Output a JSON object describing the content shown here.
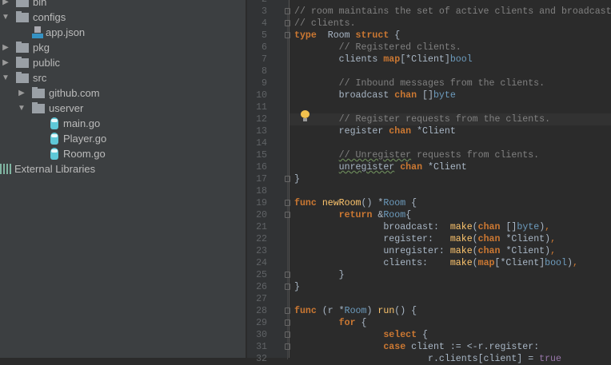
{
  "project_tree": [
    {
      "label": "bin",
      "kind": "folder",
      "depth": 0,
      "expanded": false
    },
    {
      "label": "configs",
      "kind": "folder",
      "depth": 0,
      "expanded": true
    },
    {
      "label": "app.json",
      "kind": "json-file",
      "depth": 1
    },
    {
      "label": "pkg",
      "kind": "folder",
      "depth": 0,
      "expanded": false
    },
    {
      "label": "public",
      "kind": "folder",
      "depth": 0,
      "expanded": false
    },
    {
      "label": "src",
      "kind": "folder",
      "depth": 0,
      "expanded": true
    },
    {
      "label": "github.com",
      "kind": "folder",
      "depth": 1,
      "expanded": false
    },
    {
      "label": "userver",
      "kind": "folder",
      "depth": 1,
      "expanded": true
    },
    {
      "label": "main.go",
      "kind": "go-file",
      "depth": 2
    },
    {
      "label": "Player.go",
      "kind": "go-file",
      "depth": 2
    },
    {
      "label": "Room.go",
      "kind": "go-file",
      "depth": 2
    },
    {
      "label": "External Libraries",
      "kind": "libraries",
      "depth": -1
    }
  ],
  "editor": {
    "current_line": 12,
    "intention_icon": "lightbulb-icon",
    "lines": [
      {
        "n": "2",
        "t": []
      },
      {
        "n": "3",
        "t": [
          [
            "cm",
            "// room maintains the set of active clients and broadcast"
          ]
        ]
      },
      {
        "n": "4",
        "t": [
          [
            "cm",
            "// clients."
          ]
        ]
      },
      {
        "n": "5",
        "t": [
          [
            "kw",
            "type"
          ],
          [
            "",
            "  Room "
          ],
          [
            "kw",
            "struct"
          ],
          [
            "",
            " {"
          ]
        ]
      },
      {
        "n": "6",
        "t": [
          [
            "",
            "\t"
          ],
          [
            "cm",
            "// Registered clients."
          ]
        ]
      },
      {
        "n": "7",
        "t": [
          [
            "",
            "\tclients "
          ],
          [
            "kw",
            "map"
          ],
          [
            "",
            "[*Client]"
          ],
          [
            "ty",
            "bool"
          ]
        ]
      },
      {
        "n": "8",
        "t": []
      },
      {
        "n": "9",
        "t": [
          [
            "",
            "\t"
          ],
          [
            "cm",
            "// Inbound messages from the clients."
          ]
        ]
      },
      {
        "n": "10",
        "t": [
          [
            "",
            "\tbroadcast "
          ],
          [
            "kw",
            "chan"
          ],
          [
            "",
            " []"
          ],
          [
            "ty",
            "byte"
          ]
        ]
      },
      {
        "n": "11",
        "t": []
      },
      {
        "n": "12",
        "t": [
          [
            "",
            "\t"
          ],
          [
            "cm",
            "// Register requests from the clients."
          ]
        ]
      },
      {
        "n": "13",
        "t": [
          [
            "",
            "\tregister "
          ],
          [
            "kw",
            "chan"
          ],
          [
            "",
            " *Client"
          ]
        ]
      },
      {
        "n": "14",
        "t": []
      },
      {
        "n": "15",
        "t": [
          [
            "",
            "\t"
          ],
          [
            "cm warn",
            "// Unregister"
          ],
          [
            "cm",
            " requests from clients."
          ]
        ]
      },
      {
        "n": "16",
        "t": [
          [
            "",
            "\t"
          ],
          [
            "warn",
            "unregister"
          ],
          [
            "",
            " "
          ],
          [
            "kw",
            "chan"
          ],
          [
            "",
            " *Client"
          ]
        ]
      },
      {
        "n": "17",
        "t": [
          [
            "",
            "}"
          ]
        ]
      },
      {
        "n": "18",
        "t": []
      },
      {
        "n": "19",
        "t": [
          [
            "kw",
            "func"
          ],
          [
            "",
            " "
          ],
          [
            "fn",
            "newRoom"
          ],
          [
            "",
            "() *"
          ],
          [
            "ty",
            "Room"
          ],
          [
            "",
            " {"
          ]
        ]
      },
      {
        "n": "20",
        "t": [
          [
            "",
            "\t"
          ],
          [
            "kw",
            "return"
          ],
          [
            "",
            " &"
          ],
          [
            "ty",
            "Room"
          ],
          [
            "",
            "{"
          ]
        ]
      },
      {
        "n": "21",
        "t": [
          [
            "",
            "\t\tbroadcast:  "
          ],
          [
            "fn",
            "make"
          ],
          [
            "",
            "("
          ],
          [
            "kw",
            "chan"
          ],
          [
            "",
            " []"
          ],
          [
            "ty",
            "byte"
          ],
          [
            "",
            ")"
          ],
          [
            "pu",
            ","
          ]
        ]
      },
      {
        "n": "22",
        "t": [
          [
            "",
            "\t\tregister:   "
          ],
          [
            "fn",
            "make"
          ],
          [
            "",
            "("
          ],
          [
            "kw",
            "chan"
          ],
          [
            "",
            " *Client)"
          ],
          [
            "pu",
            ","
          ]
        ]
      },
      {
        "n": "23",
        "t": [
          [
            "",
            "\t\tunregister: "
          ],
          [
            "fn",
            "make"
          ],
          [
            "",
            "("
          ],
          [
            "kw",
            "chan"
          ],
          [
            "",
            " *Client)"
          ],
          [
            "pu",
            ","
          ]
        ]
      },
      {
        "n": "24",
        "t": [
          [
            "",
            "\t\tclients:    "
          ],
          [
            "fn",
            "make"
          ],
          [
            "",
            "("
          ],
          [
            "kw",
            "map"
          ],
          [
            "",
            "[*Client]"
          ],
          [
            "ty",
            "bool"
          ],
          [
            "",
            ")"
          ],
          [
            "pu",
            ","
          ]
        ]
      },
      {
        "n": "25",
        "t": [
          [
            "",
            "\t}"
          ]
        ]
      },
      {
        "n": "26",
        "t": [
          [
            "",
            "}"
          ]
        ]
      },
      {
        "n": "27",
        "t": []
      },
      {
        "n": "28",
        "t": [
          [
            "kw",
            "func"
          ],
          [
            "",
            " (r *"
          ],
          [
            "ty",
            "Room"
          ],
          [
            "",
            ") "
          ],
          [
            "fn",
            "run"
          ],
          [
            "",
            "() {"
          ]
        ]
      },
      {
        "n": "29",
        "t": [
          [
            "",
            "\t"
          ],
          [
            "kw",
            "for"
          ],
          [
            "",
            " {"
          ]
        ]
      },
      {
        "n": "30",
        "t": [
          [
            "",
            "\t\t"
          ],
          [
            "kw",
            "select"
          ],
          [
            "",
            " {"
          ]
        ]
      },
      {
        "n": "31",
        "t": [
          [
            "",
            "\t\t"
          ],
          [
            "kw",
            "case"
          ],
          [
            "",
            " client := <-r.register:"
          ]
        ]
      },
      {
        "n": "32",
        "t": [
          [
            "",
            "\t\t\tr.clients[client] = "
          ],
          [
            "lit",
            "true"
          ]
        ]
      }
    ]
  },
  "colors": {
    "sidebar_bg": "#3c3f41",
    "editor_bg": "#2b2b2b",
    "keyword": "#cc7832",
    "comment": "#808080",
    "function": "#ffc66d"
  }
}
